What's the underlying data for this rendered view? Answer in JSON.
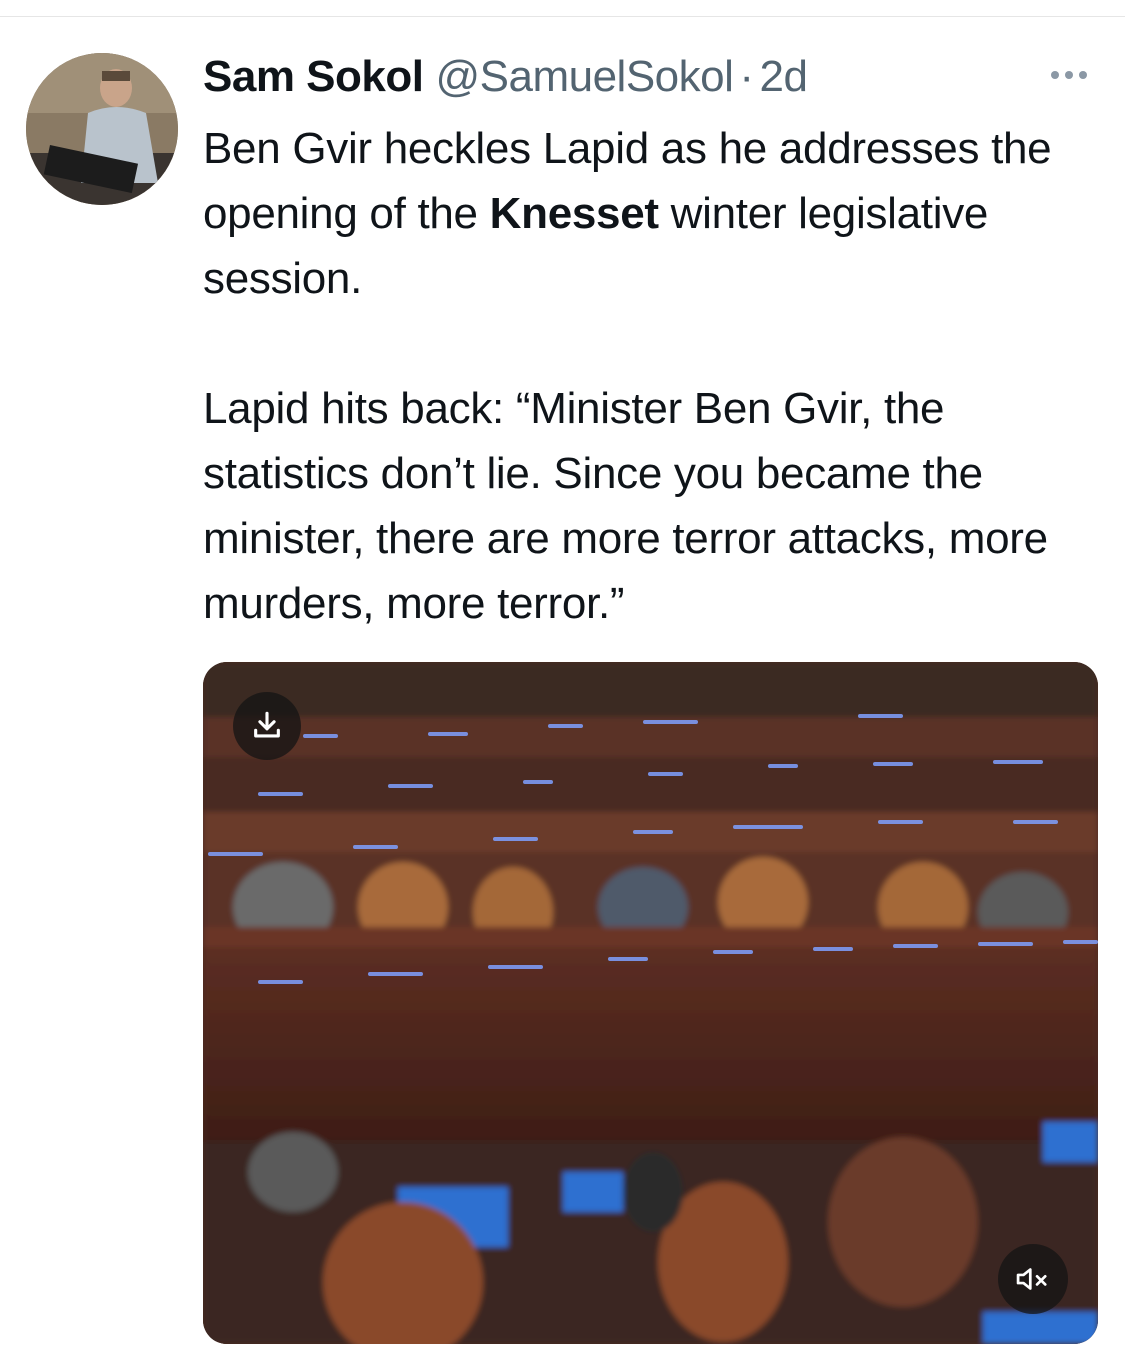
{
  "tweet": {
    "author_name": "Sam Sokol",
    "author_handle": "@SamuelSokol",
    "separator": "·",
    "time": "2d",
    "text_line1_a": "Ben Gvir heckles Lapid as he addresses the opening of the ",
    "text_line1_bold": "Knesset",
    "text_line1_b": " winter legislative session.",
    "text_para2": "Lapid hits back: “Minister Ben Gvir, the statistics don’t lie. Since you became the minister, there are more terror attacks, more murders, more terror.”"
  },
  "icons": {
    "more": "more-horizontal-icon",
    "download": "download-icon",
    "mute": "muted-speaker-icon"
  },
  "colors": {
    "text": "#0f1419",
    "secondary": "#536471"
  }
}
